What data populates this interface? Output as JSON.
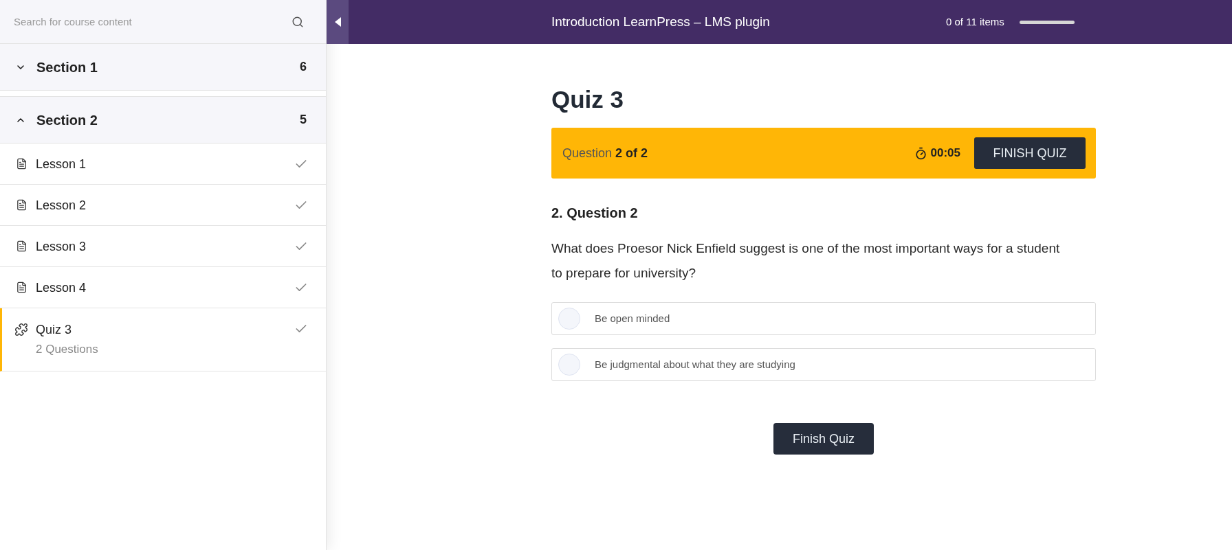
{
  "sidebar": {
    "search": {
      "placeholder": "Search for course content"
    },
    "sections": [
      {
        "title": "Section 1",
        "count": "6",
        "expanded": false
      },
      {
        "title": "Section 2",
        "count": "5",
        "expanded": true,
        "items": [
          {
            "kind": "lesson",
            "title": "Lesson 1",
            "completed": true,
            "selected": false
          },
          {
            "kind": "lesson",
            "title": "Lesson 2",
            "completed": true,
            "selected": false
          },
          {
            "kind": "lesson",
            "title": "Lesson 3",
            "completed": true,
            "selected": false
          },
          {
            "kind": "lesson",
            "title": "Lesson 4",
            "completed": true,
            "selected": false
          },
          {
            "kind": "quiz",
            "title": "Quiz 3",
            "meta": "2 Questions",
            "completed": true,
            "selected": true
          }
        ]
      }
    ]
  },
  "topbar": {
    "course_title": "Introduction LearnPress – LMS plugin",
    "progress": {
      "label": "0 of 11 items",
      "level": 0
    }
  },
  "quiz": {
    "title": "Quiz 3",
    "status": "Question **2 of 2**",
    "timer": "00:05",
    "finish_button": "FINISH QUIZ",
    "question": {
      "title": "2. Question 2",
      "text": "What does Proesor Nick Enfield suggest is one of the most important ways for a student to prepare for university?",
      "options": [
        {
          "label": "Be open minded",
          "selected": false
        },
        {
          "label": "Be judgmental about what they are studying",
          "selected": false
        }
      ]
    },
    "submit_button": "Finish Quiz"
  }
}
